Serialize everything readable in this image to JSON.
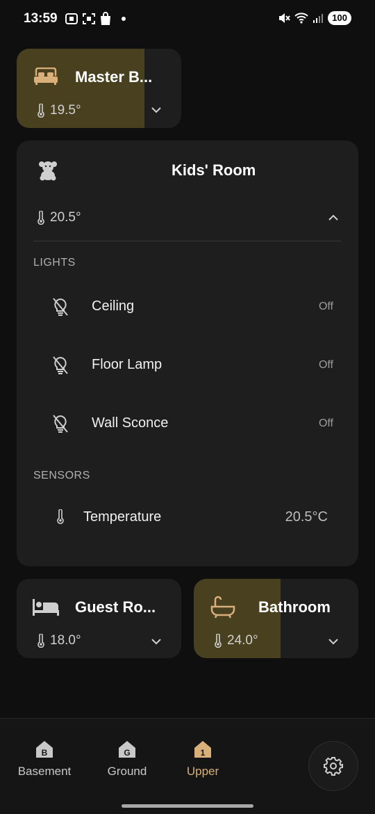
{
  "status_bar": {
    "time": "13:59",
    "battery": "100",
    "left_icons": [
      "screen-record-icon",
      "screenshot-icon",
      "shopping-bag-icon"
    ],
    "right_icons": [
      "mute-icon",
      "wifi-icon",
      "signal-icon"
    ]
  },
  "rooms": [
    {
      "id": "master",
      "title": "Master B...",
      "temp": "19.5°",
      "icon": "bed-icon",
      "active": true,
      "expanded": false
    },
    {
      "id": "kids",
      "title": "Kids' Room",
      "temp": "20.5°",
      "icon": "teddy-bear-icon",
      "active": false,
      "expanded": true
    },
    {
      "id": "guest",
      "title": "Guest Ro...",
      "temp": "18.0°",
      "icon": "guest-bed-icon",
      "active": false,
      "expanded": false
    },
    {
      "id": "bathroom",
      "title": "Bathroom",
      "temp": "24.0°",
      "icon": "bathtub-icon",
      "active": true,
      "expanded": false
    }
  ],
  "kids_room": {
    "lights_label": "LIGHTS",
    "lights": [
      {
        "name": "Ceiling",
        "state": "Off"
      },
      {
        "name": "Floor Lamp",
        "state": "Off"
      },
      {
        "name": "Wall Sconce",
        "state": "Off"
      }
    ],
    "sensors_label": "SENSORS",
    "sensors": [
      {
        "name": "Temperature",
        "value": "20.5°C"
      }
    ]
  },
  "nav": {
    "items": [
      {
        "label": "Basement",
        "icon": "floor-b-icon",
        "active": false
      },
      {
        "label": "Ground",
        "icon": "floor-g-icon",
        "active": false
      },
      {
        "label": "Upper",
        "icon": "floor-1-icon",
        "active": true
      }
    ],
    "settings_icon": "gear-icon"
  },
  "colors": {
    "accent": "#d9b07a",
    "card": "#1e1e1e",
    "glow": "#48401f",
    "background": "#0f0f0f"
  }
}
